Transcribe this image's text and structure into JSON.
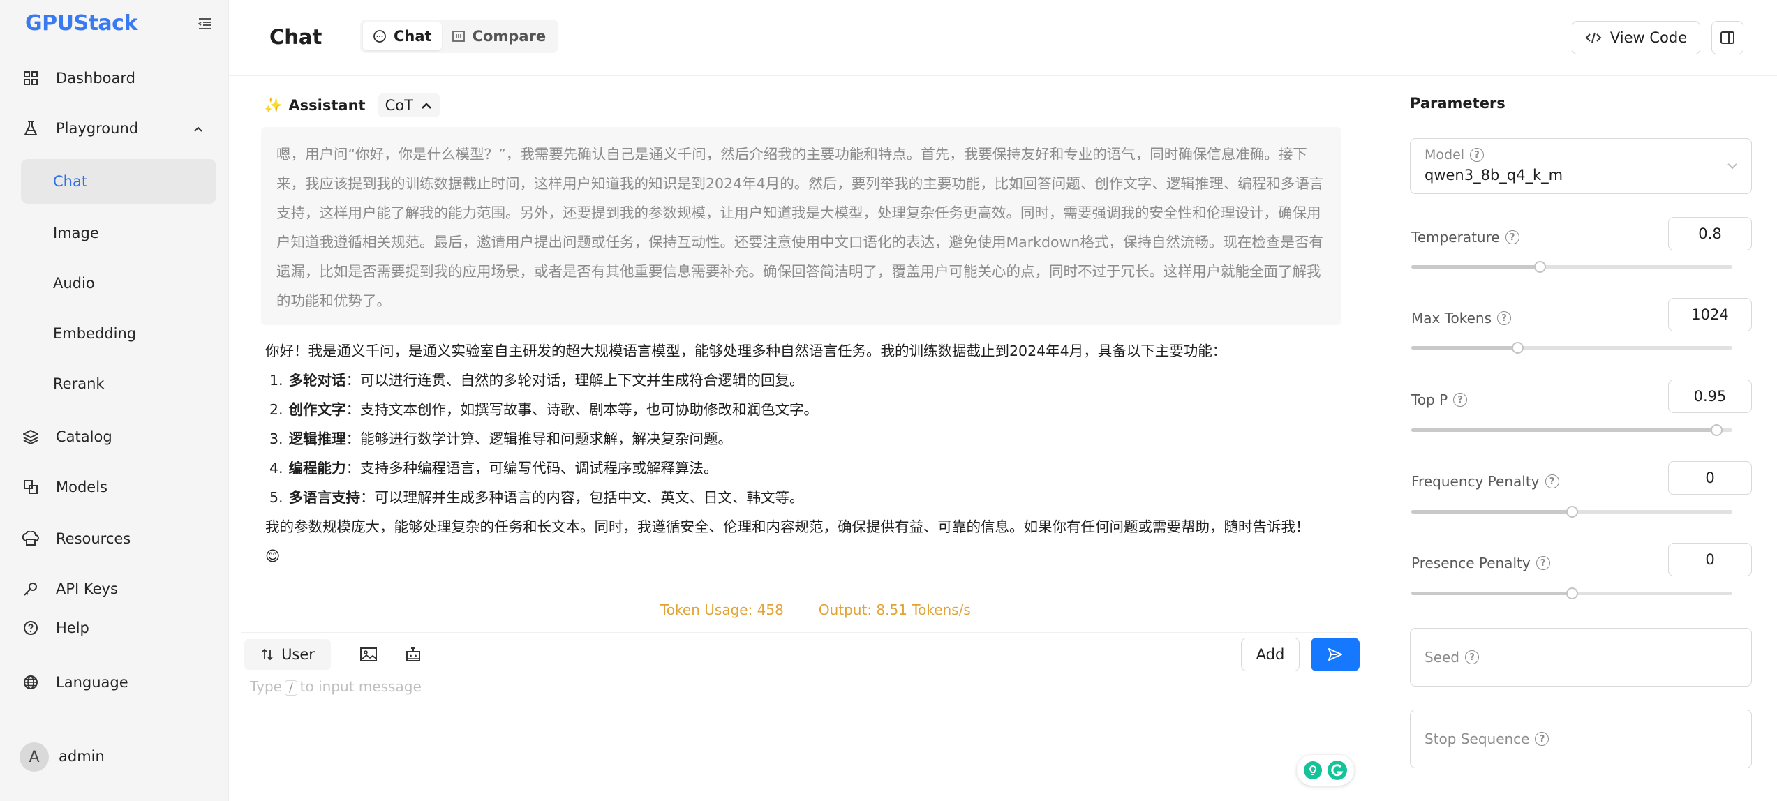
{
  "sidebar": {
    "logo": "GPUStack",
    "items": [
      {
        "label": "Dashboard"
      },
      {
        "label": "Playground"
      },
      {
        "label": "Catalog"
      },
      {
        "label": "Models"
      },
      {
        "label": "Resources"
      },
      {
        "label": "API Keys"
      },
      {
        "label": "Help"
      },
      {
        "label": "Language"
      }
    ],
    "sub_items": [
      {
        "label": "Chat"
      },
      {
        "label": "Image"
      },
      {
        "label": "Audio"
      },
      {
        "label": "Embedding"
      },
      {
        "label": "Rerank"
      }
    ],
    "user": {
      "initial": "A",
      "name": "admin"
    }
  },
  "header": {
    "title": "Chat",
    "tabs": [
      {
        "label": "Chat"
      },
      {
        "label": "Compare"
      }
    ],
    "view_code": "View Code"
  },
  "chat": {
    "assistant_label": "Assistant",
    "cot_label": "CoT",
    "thinking": "嗯，用户问“你好，你是什么模型？”，我需要先确认自己是通义千问，然后介绍我的主要功能和特点。首先，我要保持友好和专业的语气，同时确保信息准确。接下来，我应该提到我的训练数据截止时间，这样用户知道我的知识是到2024年4月的。然后，要列举我的主要功能，比如回答问题、创作文字、逻辑推理、编程和多语言支持，这样用户能了解我的能力范围。另外，还要提到我的参数规模，让用户知道我是大模型，处理复杂任务更高效。同时，需要强调我的安全性和伦理设计，确保用户知道我遵循相关规范。最后，邀请用户提出问题或任务，保持互动性。还要注意使用中文口语化的表达，避免使用Markdown格式，保持自然流畅。现在检查是否有遗漏，比如是否需要提到我的应用场景，或者是否有其他重要信息需要补充。确保回答简洁明了，覆盖用户可能关心的点，同时不过于冗长。这样用户就能全面了解我的功能和优势了。",
    "answer_intro": "你好！我是通义千问，是通义实验室自主研发的超大规模语言模型，能够处理多种自然语言任务。我的训练数据截止到2024年4月，具备以下主要功能：",
    "features": [
      {
        "num": "1.",
        "title": "多轮对话",
        "desc": "：可以进行连贯、自然的多轮对话，理解上下文并生成符合逻辑的回复。"
      },
      {
        "num": "2.",
        "title": "创作文字",
        "desc": "：支持文本创作，如撰写故事、诗歌、剧本等，也可协助修改和润色文字。"
      },
      {
        "num": "3.",
        "title": "逻辑推理",
        "desc": "：能够进行数学计算、逻辑推导和问题求解，解决复杂问题。"
      },
      {
        "num": "4.",
        "title": "编程能力",
        "desc": "：支持多种编程语言，可编写代码、调试程序或解释算法。"
      },
      {
        "num": "5.",
        "title": "多语言支持",
        "desc": "：可以理解并生成多种语言的内容，包括中文、英文、日文、韩文等。"
      }
    ],
    "answer_outro": "我的参数规模庞大，能够处理复杂的任务和长文本。同时，我遵循安全、伦理和内容规范，确保提供有益、可靠的信息。如果你有任何问题或需要帮助，随时告诉我！",
    "emoji": "😊",
    "token_usage": "Token Usage: 458",
    "output_speed": "Output: 8.51 Tokens/s"
  },
  "input": {
    "role": "User",
    "placeholder_pre": "Type",
    "placeholder_key": "/",
    "placeholder_post": "to input message",
    "add_label": "Add"
  },
  "parameters": {
    "title": "Parameters",
    "model": {
      "label": "Model",
      "value": "qwen3_8b_q4_k_m"
    },
    "sliders": [
      {
        "label": "Temperature",
        "value": "0.8",
        "fraction": 0.4
      },
      {
        "label": "Max Tokens",
        "value": "1024",
        "fraction": 0.33
      },
      {
        "label": "Top P",
        "value": "0.95",
        "fraction": 0.95
      },
      {
        "label": "Frequency Penalty",
        "value": "0",
        "fraction": 0.5
      },
      {
        "label": "Presence Penalty",
        "value": "0",
        "fraction": 0.5
      }
    ],
    "seed_label": "Seed",
    "stop_label": "Stop Sequence"
  },
  "colors": {
    "accent": "#1677ff",
    "token": "#e2a336",
    "logo": "#2f6fe8"
  }
}
